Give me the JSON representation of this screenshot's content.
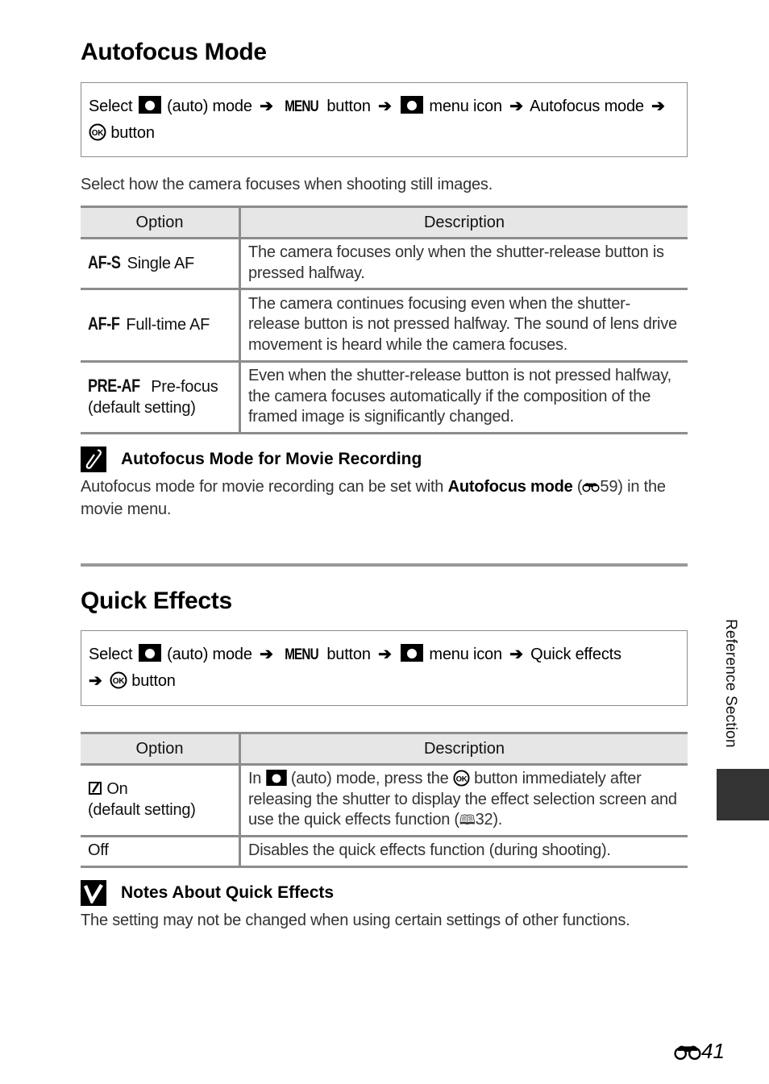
{
  "sections": {
    "autofocus": {
      "title": "Autofocus Mode",
      "path": {
        "select": "Select",
        "auto_mode": "(auto) mode",
        "menu_glyph": "MENU",
        "button": "button",
        "menu_icon": "menu icon",
        "target": "Autofocus mode",
        "ok_button": "button",
        "icons": [
          "camera-icon",
          "arrow-icon",
          "menu-button-icon",
          "camera-icon",
          "ok-button-icon"
        ]
      },
      "intro": "Select how the camera focuses when shooting still images.",
      "table": {
        "headers": [
          "Option",
          "Description"
        ],
        "rows": [
          {
            "icon": "AF-S",
            "option": "Single AF",
            "option2": "",
            "description": "The camera focuses only when the shutter-release button is pressed halfway."
          },
          {
            "icon": "AF-F",
            "option": "Full-time AF",
            "option2": "",
            "description": "The camera continues focusing even when the shutter-release button is not pressed halfway. The sound of lens drive movement is heard while the camera focuses."
          },
          {
            "icon": "PRE-AF",
            "option": "Pre-focus",
            "option2": "(default setting)",
            "description": "Even when the shutter-release button is not pressed halfway, the camera focuses automatically if the composition of the framed image is significantly changed."
          }
        ]
      },
      "note": {
        "icon": "pencil-note-icon",
        "title": "Autofocus Mode for Movie Recording",
        "text_before": "Autofocus mode for movie recording can be set with ",
        "text_bold": "Autofocus mode",
        "text_ref_open": " (",
        "text_ref_page": "59",
        "text_after": ") in the movie menu."
      }
    },
    "quick_effects": {
      "title": "Quick Effects",
      "path": {
        "select": "Select",
        "auto_mode": "(auto) mode",
        "menu_glyph": "MENU",
        "button": "button",
        "menu_icon": "menu icon",
        "target": "Quick effects",
        "ok_button": "button"
      },
      "table": {
        "headers": [
          "Option",
          "Description"
        ],
        "rows": [
          {
            "option": "On",
            "option2": "(default setting)",
            "desc_1": "In",
            "desc_2": "(auto) mode, press the",
            "desc_3": "button immediately after releasing the shutter to display the effect selection screen and use the quick effects function (",
            "desc_ref": "32",
            "desc_4": ")."
          },
          {
            "option": "Off",
            "description": "Disables the quick effects function (during shooting)."
          }
        ]
      },
      "note": {
        "icon": "check-note-icon",
        "title": "Notes About Quick Effects",
        "text": "The setting may not be changed when using certain settings of other functions."
      }
    }
  },
  "side": {
    "label": "Reference Section"
  },
  "page": {
    "number": "41"
  }
}
